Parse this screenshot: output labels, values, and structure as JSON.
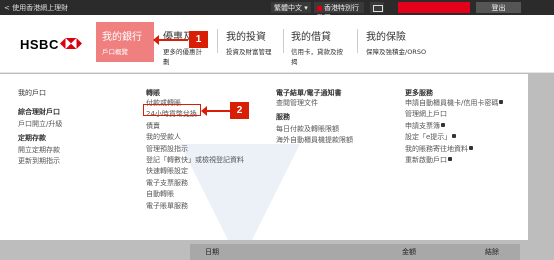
{
  "topbar": {
    "tip": "< 使用香港網上理財",
    "language": "繁體中文 ▾",
    "region": "香港特別行政區",
    "logout": "登出"
  },
  "brand": {
    "name": "HSBC"
  },
  "nav": [
    {
      "title": "我的銀行",
      "sub": "戶口概覽",
      "active": true
    },
    {
      "title": "優惠及",
      "sub": "更多的優惠計劃",
      "active": false
    },
    {
      "title": "我的投資",
      "sub": "投資及財富管理",
      "active": false
    },
    {
      "title": "我的借貸",
      "sub": "信用卡，貸款及按揭",
      "active": false
    },
    {
      "title": "我的保險",
      "sub": "保障及強積金/ORSO",
      "active": false
    }
  ],
  "badges": {
    "one": "1",
    "two": "2"
  },
  "menu": {
    "col1": {
      "heading": "我的戶口",
      "groups": [
        {
          "title": "綜合理財戶口",
          "items": [
            "戶口開立/升級"
          ]
        },
        {
          "title": "定期存款",
          "items": [
            "開立定期存款",
            "更新到期指示"
          ]
        }
      ]
    },
    "col2": {
      "heading": "轉賬",
      "items": [
        "付款或轉賬",
        "24小時貨幣兌換",
        "債賣",
        "我的受款人",
        "管理預設指示",
        "登記「轉數快」或檢視登記資料",
        "快速轉賬設定",
        "電子支票服務",
        "自動轉賬",
        "電子賬單服務"
      ]
    },
    "col3": {
      "heading": "電子結單/電子通知書",
      "items": [
        "查閱管理文件"
      ],
      "group": {
        "title": "服務",
        "items": [
          "每日付款及轉賬限額",
          "海外自動櫃員機提款限額"
        ]
      }
    },
    "col4": {
      "heading": "更多服務",
      "items": [
        {
          "label": "申請自動櫃員機卡/信用卡密碼",
          "locked": true
        },
        {
          "label": "管理網上戶口",
          "locked": false
        },
        {
          "label": "申請支票簿",
          "locked": true
        },
        {
          "label": "設定「e提示」",
          "locked": true
        },
        {
          "label": "我的賬務寄往地資料",
          "locked": true
        },
        {
          "label": "重新啟動戶口",
          "locked": true
        }
      ]
    }
  },
  "bottom": {
    "date": "日期",
    "amount": "金額",
    "balance": "結餘"
  },
  "colors": {
    "accent": "#d81e05",
    "active_nav": "#f08080",
    "topbar": "#2b2b2b"
  }
}
